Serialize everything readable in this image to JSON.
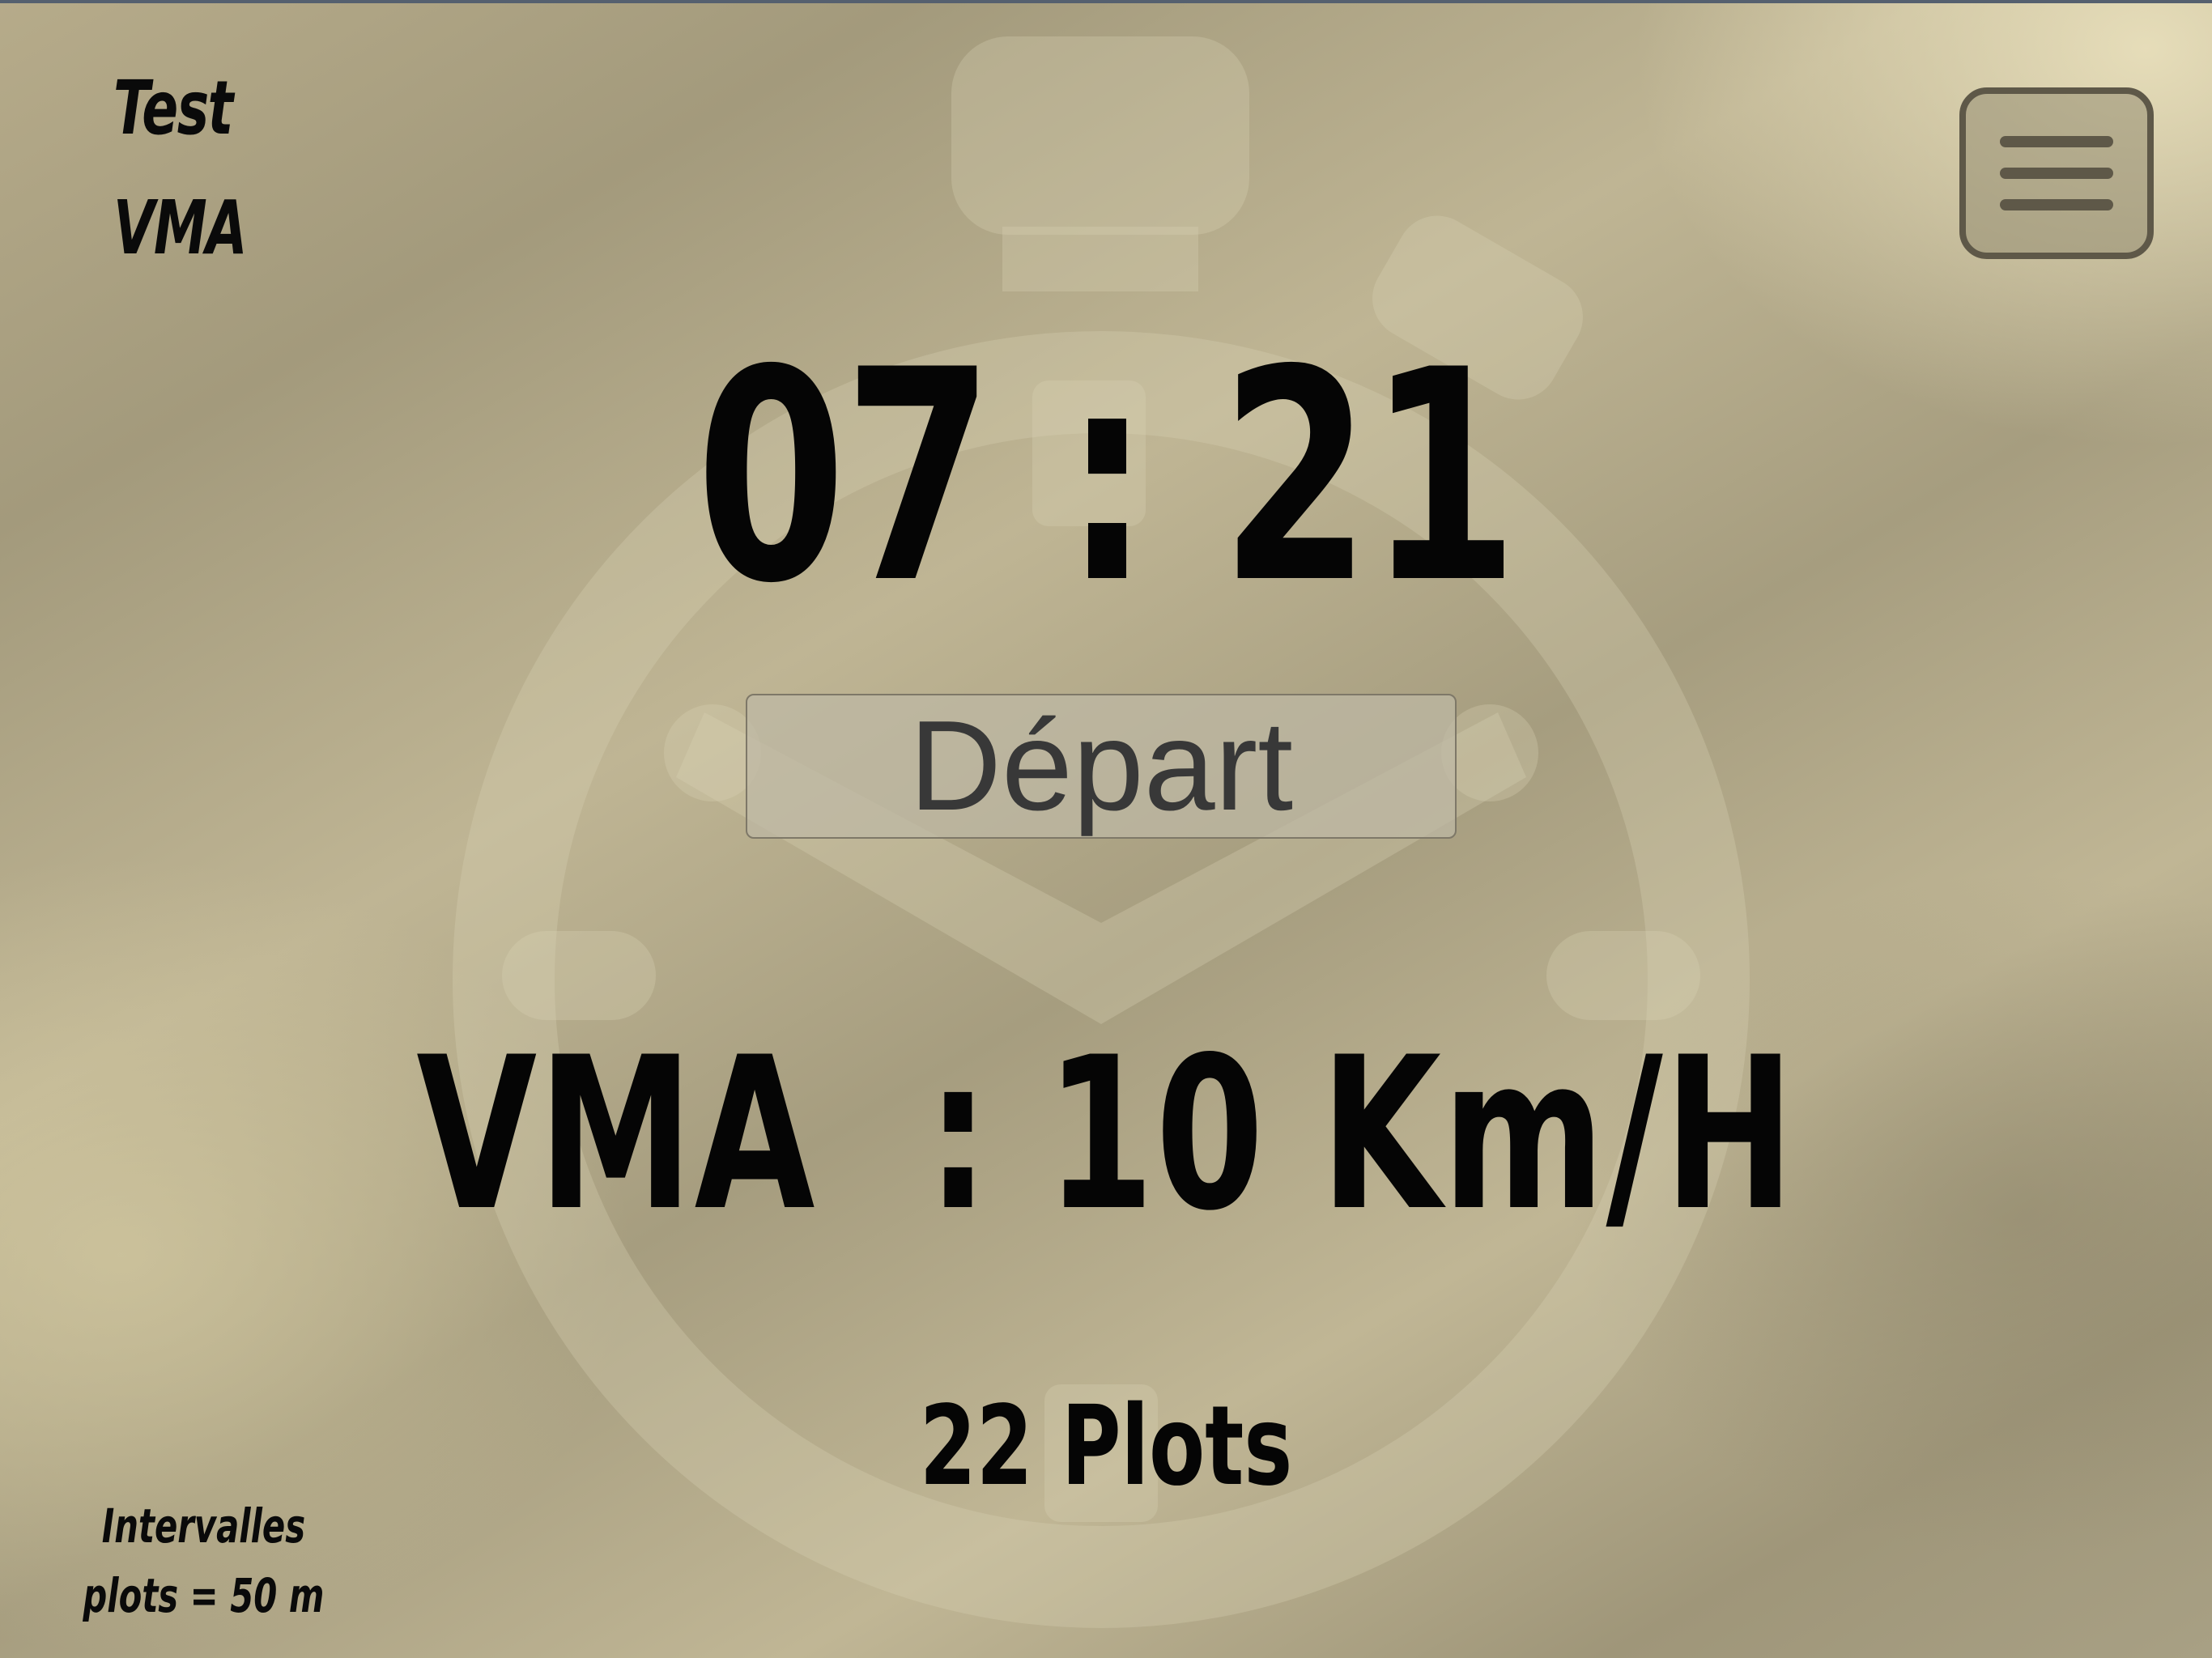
{
  "app": {
    "title_line1": "Test",
    "title_line2": "VMA"
  },
  "menu": {
    "icon": "hamburger-menu-icon"
  },
  "timer": {
    "display": "07 : 21"
  },
  "controls": {
    "start_label": "Départ"
  },
  "vma": {
    "label": "VMA  : 10 Km/H"
  },
  "plots": {
    "count_label": "22 Plots"
  },
  "note": {
    "line1": "Intervalles",
    "line2": "plots = 50 m"
  },
  "background": {
    "icon": "stopwatch-icon"
  },
  "colors": {
    "text": "#050505",
    "menu_border": "#5e5848",
    "button_text": "#383838"
  }
}
